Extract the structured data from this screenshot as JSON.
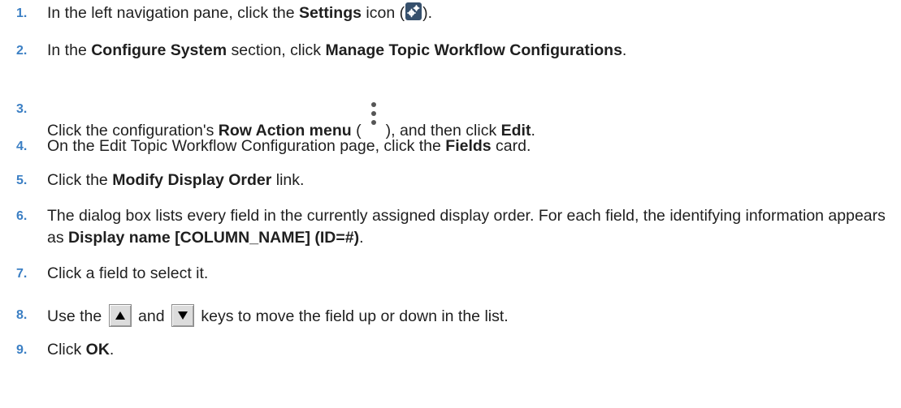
{
  "steps": [
    {
      "number": "1.",
      "pre": "In the left navigation pane, click the ",
      "bold1": "Settings",
      "mid": " icon (",
      "icon": "settings-gear-icon",
      "post": ")."
    },
    {
      "number": "2.",
      "pre": "In the ",
      "bold1": "Configure System",
      "mid": " section, click ",
      "bold2": "Manage Topic Workflow Configurations",
      "post": "."
    },
    {
      "number": "3.",
      "pre": "Click the configuration's ",
      "bold1": "Row Action menu",
      "mid": " (",
      "icon": "kebab-menu-icon",
      "mid2": "), and then click ",
      "bold2": "Edit",
      "post": "."
    },
    {
      "number": "4.",
      "pre": "On the Edit Topic Workflow Configuration page, click the ",
      "bold1": "Fields",
      "post": " card."
    },
    {
      "number": "5.",
      "pre": "Click the ",
      "bold1": "Modify Display Order",
      "post": " link."
    },
    {
      "number": "6.",
      "pre": "The dialog box lists every field in the currently assigned display order. For each field, the identifying information appears as ",
      "bold1": "Display name [COLUMN_NAME] (ID=#)",
      "post": "."
    },
    {
      "number": "7.",
      "pre": "Click a field to select it."
    },
    {
      "number": "8.",
      "pre": "Use the ",
      "icon1": "up-arrow-key-icon",
      "mid": " and ",
      "icon2": "down-arrow-key-icon",
      "post": " keys to move the field up or down in the list."
    },
    {
      "number": "9.",
      "pre": "Click ",
      "bold1": "OK",
      "post": "."
    }
  ],
  "colors": {
    "step_number": "#3b7fc4",
    "body_text": "#1f1f1f",
    "settings_icon_bg": "#36506c"
  }
}
